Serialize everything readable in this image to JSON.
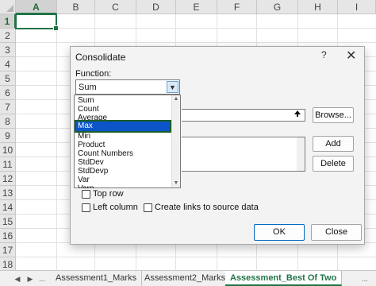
{
  "spreadsheet": {
    "columns": [
      "A",
      "B",
      "C",
      "D",
      "E",
      "F",
      "G",
      "H",
      "I"
    ],
    "rows": [
      "1",
      "2",
      "3",
      "4",
      "5",
      "6",
      "7",
      "8",
      "9",
      "10",
      "11",
      "12",
      "13",
      "14",
      "15",
      "16",
      "17",
      "18"
    ],
    "selected_column": "A",
    "selected_row": "1"
  },
  "sheet_tabs": {
    "nav_prev": "◀",
    "nav_next": "▶",
    "ellipsis": "...",
    "tabs": [
      {
        "label": "Assessment1_Marks",
        "active": false
      },
      {
        "label": "Assessment2_Marks",
        "active": false
      },
      {
        "label": "Assessment_Best Of Two",
        "active": true
      }
    ]
  },
  "dialog": {
    "title": "Consolidate",
    "help": "?",
    "close": "✕",
    "function_label": "Function:",
    "function_value": "Sum",
    "function_options": [
      "Sum",
      "Count",
      "Average",
      "Max",
      "Min",
      "Product",
      "Count Numbers",
      "StdDev",
      "StdDevp",
      "Var",
      "Varp"
    ],
    "highlighted_option": "Max",
    "browse_label": "Browse...",
    "add_label": "Add",
    "delete_label": "Delete",
    "top_row_label": "Top row",
    "left_column_label": "Left column",
    "create_links_label": "Create links to source data",
    "ok_label": "OK",
    "close_label": "Close",
    "ref_button_icon": "collapse-arrow-icon"
  },
  "colors": {
    "accent": "#217346",
    "highlight": "#0b55c9"
  }
}
